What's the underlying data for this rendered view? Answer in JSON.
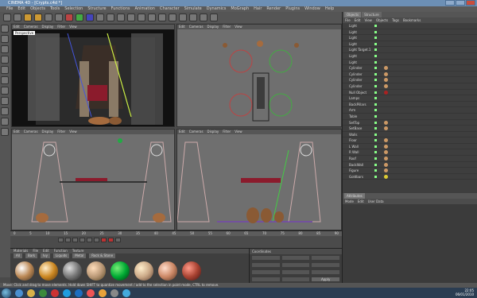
{
  "window": {
    "title": "CINEMA 4D - [Crypts.c4d *]"
  },
  "menubar": [
    "File",
    "Edit",
    "Objects",
    "Tools",
    "Selection",
    "Structure",
    "Functions",
    "Animation",
    "Character",
    "Simulate",
    "Dynamics",
    "MoGraph",
    "Hair",
    "Render",
    "Plugins",
    "Window",
    "Help"
  ],
  "viewport_menu": [
    "Edit",
    "Cameras",
    "Display",
    "Filter",
    "View"
  ],
  "viewports": {
    "perspective_label": "Perspective"
  },
  "object_manager": {
    "tabs": [
      "Objects",
      "Structure"
    ],
    "menu": [
      "File",
      "Edit",
      "View",
      "Objects",
      "Tags",
      "Bookmarks"
    ],
    "objects": [
      "Light",
      "Light",
      "Light",
      "Light",
      "Light Target.1",
      "Light",
      "Light",
      "Cylinder",
      "Cylinder",
      "Cylinder",
      "Cylinder",
      "Null Object",
      "Lamps",
      "BackPillars",
      "Arm",
      "Table",
      "SetTop",
      "SetBase",
      "Walls",
      "Floor",
      "L Wall",
      "R Wall",
      "Roof",
      "BackWall",
      "Figure",
      "Goldbars"
    ]
  },
  "attributes": {
    "title": "Attributes",
    "menu": [
      "Mode",
      "Edit",
      "User Data"
    ]
  },
  "timeline": {
    "ticks": [
      "0",
      "5",
      "10",
      "15",
      "20",
      "25",
      "30",
      "35",
      "40",
      "45",
      "50",
      "55",
      "60",
      "65",
      "70",
      "75",
      "80",
      "85",
      "90"
    ]
  },
  "materials": {
    "title": "Materials",
    "menu": [
      "File",
      "Edit",
      "Function",
      "Texture"
    ],
    "tabs": [
      "All",
      "Bark",
      "Ivy",
      "Liquids",
      "Metal",
      "Rock & Stone"
    ]
  },
  "coordinates": {
    "title": "Coordinates",
    "apply": "Apply"
  },
  "status": "Move: Click and drag to move elements. Hold down SHIFT to quantize movement / add to the selection in point mode, CTRL to remove.",
  "clock": {
    "time": "22:05",
    "date": "06/01/2010"
  }
}
